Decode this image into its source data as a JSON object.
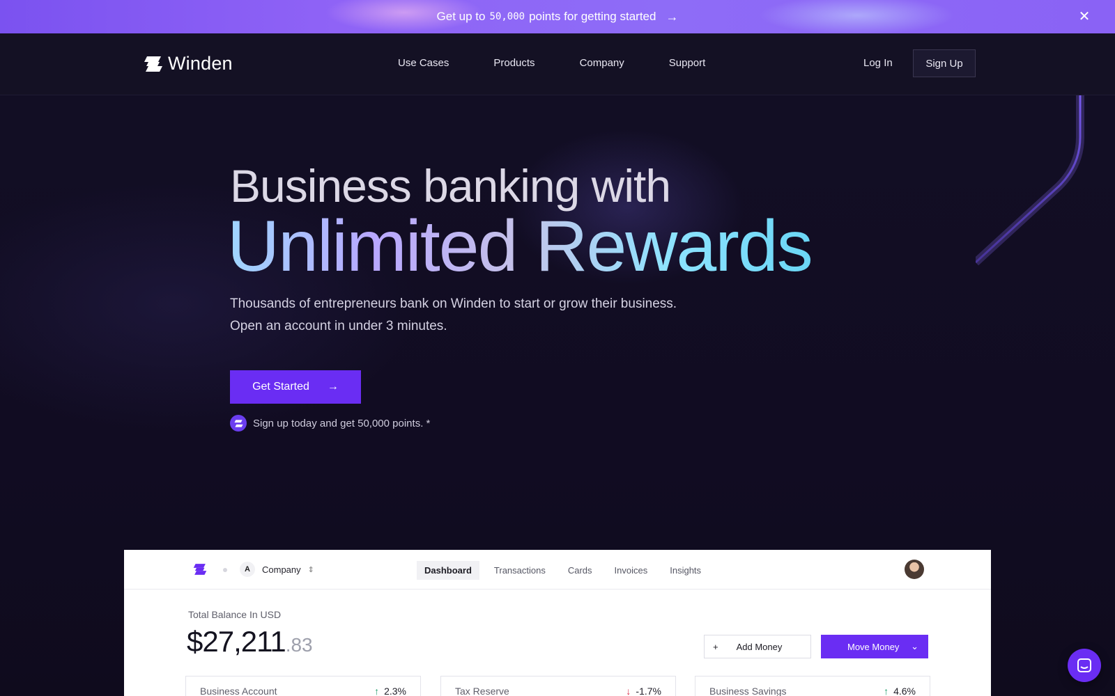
{
  "banner": {
    "text_before": "Get up to",
    "points": "50,000",
    "text_after": "points for getting started",
    "arrow_icon": "arrow-right-icon",
    "close_icon": "close-icon"
  },
  "header": {
    "logo_text": "Winden",
    "nav": [
      "Use Cases",
      "Products",
      "Company",
      "Support"
    ],
    "login_label": "Log In",
    "signup_label": "Sign Up"
  },
  "hero": {
    "title_line1": "Business banking with",
    "title_line2": "Unlimited Rewards",
    "subtitle_line1": "Thousands of entrepreneurs bank on Winden to start or grow their business.",
    "subtitle_line2": "Open an account in under 3 minutes.",
    "cta_label": "Get Started",
    "note": "Sign up today and get 50,000 points. *"
  },
  "dashboard": {
    "company_initial": "A",
    "company_name": "Company",
    "tabs": [
      "Dashboard",
      "Transactions",
      "Cards",
      "Invoices",
      "Insights"
    ],
    "active_tab": "Dashboard",
    "balance_label": "Total Balance In USD",
    "balance_whole": "$27,211",
    "balance_cents": ".83",
    "add_money_label": "Add Money",
    "move_money_label": "Move Money",
    "accounts": [
      {
        "name": "Business Account",
        "change": "2.3%",
        "direction": "up"
      },
      {
        "name": "Tax Reserve",
        "change": "-1.7%",
        "direction": "down"
      },
      {
        "name": "Business Savings",
        "change": "4.6%",
        "direction": "up"
      }
    ]
  },
  "colors": {
    "accent": "#6a2df3",
    "background": "#0e0b1c",
    "banner": "#8a5ff5"
  }
}
